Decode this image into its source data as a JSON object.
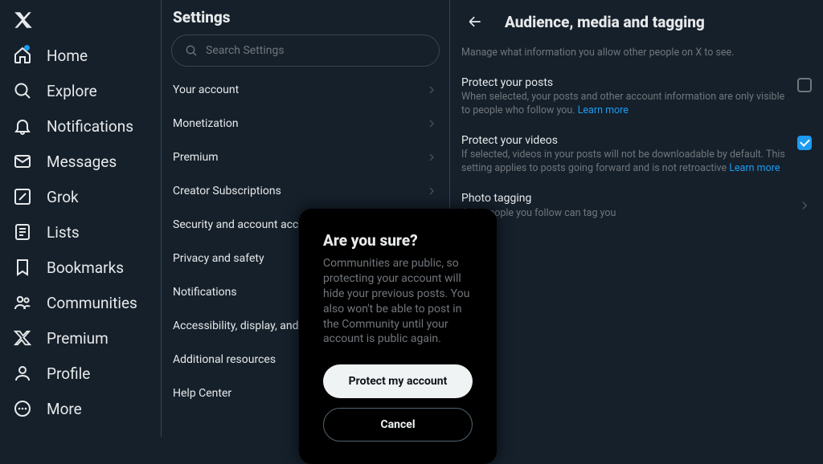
{
  "nav": {
    "items": [
      {
        "id": "home",
        "label": "Home",
        "dot": true
      },
      {
        "id": "explore",
        "label": "Explore"
      },
      {
        "id": "notifications",
        "label": "Notifications"
      },
      {
        "id": "messages",
        "label": "Messages"
      },
      {
        "id": "grok",
        "label": "Grok"
      },
      {
        "id": "lists",
        "label": "Lists"
      },
      {
        "id": "bookmarks",
        "label": "Bookmarks"
      },
      {
        "id": "communities",
        "label": "Communities"
      },
      {
        "id": "premium",
        "label": "Premium"
      },
      {
        "id": "profile",
        "label": "Profile"
      },
      {
        "id": "more",
        "label": "More"
      }
    ]
  },
  "settings": {
    "title": "Settings",
    "search_placeholder": "Search Settings",
    "items": [
      "Your account",
      "Monetization",
      "Premium",
      "Creator Subscriptions",
      "Security and account access",
      "Privacy and safety",
      "Notifications",
      "Accessibility, display, and languages",
      "Additional resources",
      "Help Center"
    ]
  },
  "detail": {
    "title": "Audience, media and tagging",
    "subtitle": "Manage what information you allow other people on X to see.",
    "protect_posts": {
      "title": "Protect your posts",
      "desc": "When selected, your posts and other account information are only visible to people who follow you. ",
      "link": "Learn more",
      "checked": false
    },
    "protect_videos": {
      "title": "Protect your videos",
      "desc": "If selected, videos in your posts will not be downloadable by default. This setting applies to posts going forward and is not retroactive ",
      "link": "Learn more",
      "checked": true
    },
    "photo_tagging": {
      "title": "Photo tagging",
      "desc": "Only people you follow can tag you"
    }
  },
  "modal": {
    "title": "Are you sure?",
    "body": "Communities are public, so protecting your account will hide your previous posts. You also won't be able to post in the Community until your account is public again.",
    "primary": "Protect my account",
    "secondary": "Cancel"
  }
}
